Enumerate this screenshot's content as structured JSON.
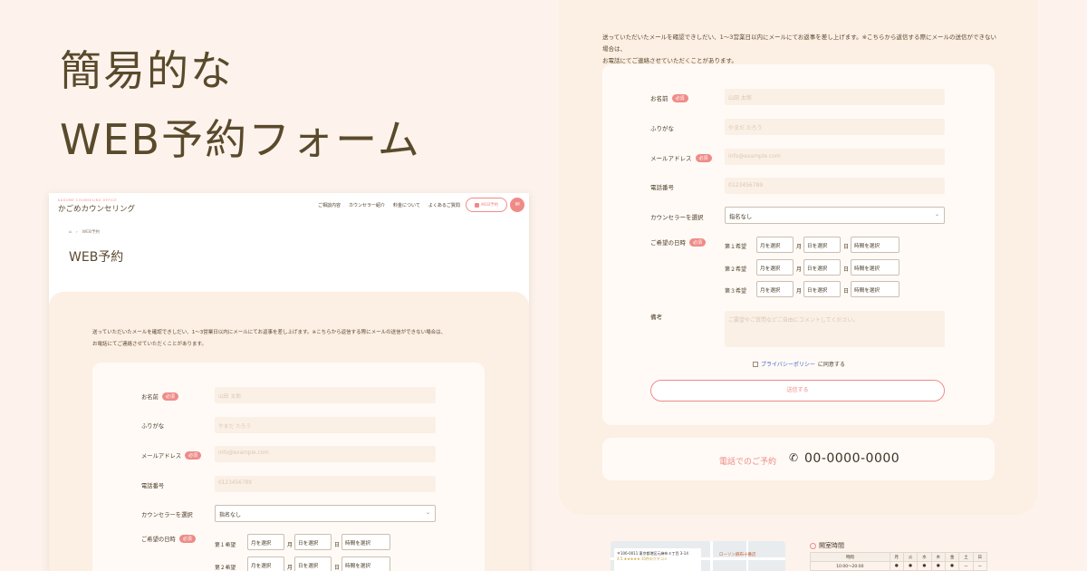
{
  "headline": {
    "line1": "簡易的な",
    "line2": "WEB予約フォーム"
  },
  "form": {
    "intro_line1": "送っていただいたメールを確認できしだい、1〜3営業日以内にメールにてお返事を差し上げます。※こちらから返信する際にメールの送信ができない場合は、",
    "intro_line2": "お電話にてご連絡させていただくことがあります。",
    "required": "必須",
    "name_label": "お名前",
    "name_placeholder": "山田 太郎",
    "kana_label": "ふりがな",
    "kana_placeholder": "やまだ たろう",
    "email_label": "メールアドレス",
    "email_placeholder": "info@example.com",
    "tel_label": "電話番号",
    "tel_placeholder": "0123456789",
    "counselor_label": "カウンセラーを選択",
    "counselor_value": "指名なし",
    "wish_label": "ご希望の日時",
    "wishes": [
      "第１希望",
      "第２希望",
      "第３希望"
    ],
    "month_select": "月を選択",
    "day_select": "日を選択",
    "time_select": "時間を選択",
    "month_unit": "月",
    "day_unit": "日",
    "notes_label": "備考",
    "notes_placeholder": "ご要望やご質問などご自由にコメントしてください。",
    "privacy_link": "プライバシーポリシー",
    "privacy_text": "に同意する",
    "submit": "送信する",
    "phone_label": "電話でのご予約",
    "phone_number": "00-0000-0000"
  },
  "hours": {
    "title": "開室時間",
    "header": [
      "時間",
      "月",
      "火",
      "水",
      "木",
      "金",
      "土",
      "日"
    ],
    "row1_time": "10:00〜20:00",
    "dot": "●",
    "dash": "ー"
  },
  "map": {
    "label": "ローソン麻布十番店",
    "card_line1": "〒106-0011 東京都港区元麻布４丁目 3-14",
    "card_line2": "4.5 ★★★★★ 15件のクチコミ"
  },
  "site": {
    "logo_sub": "KAGOME COUNSELING OFFICE",
    "logo": "かごめカウンセリング",
    "nav": [
      "ご相談内容",
      "カウンセラー紹介",
      "料金について",
      "よくあるご質問"
    ],
    "book_btn": "WEB予約",
    "mail_icon": "✉",
    "breadcrumb_home": "⌂",
    "breadcrumb_sep": "›",
    "breadcrumb_current": "WEB予約",
    "page_title": "WEB予約"
  }
}
